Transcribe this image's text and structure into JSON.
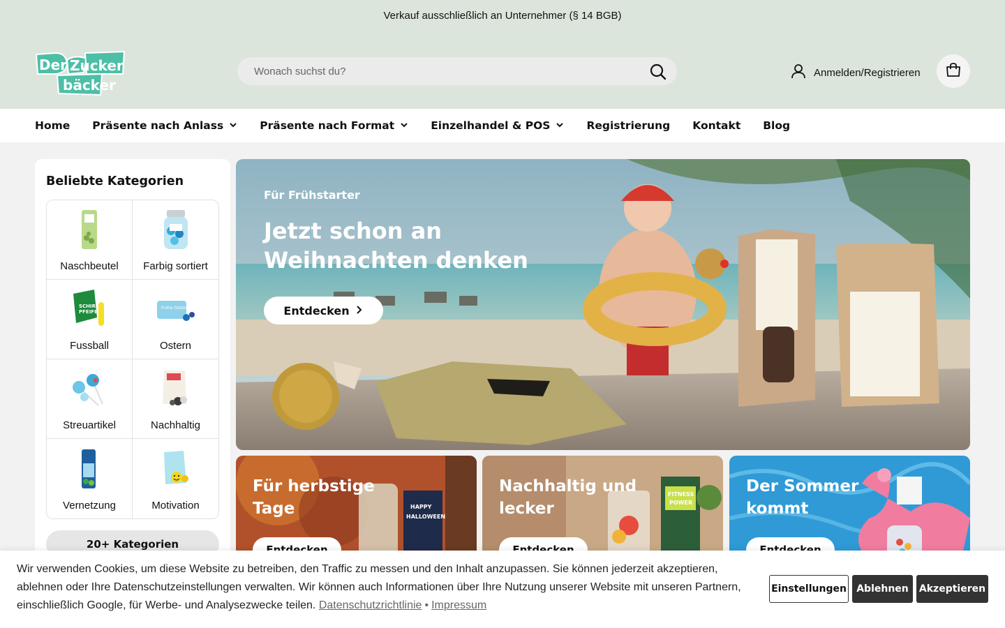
{
  "announcement": "Verkauf ausschließlich an Unternehmer (§ 14 BGB)",
  "brand": {
    "logo_alt": "Der Zucker bäcker",
    "accent": "#4dbfa6"
  },
  "search": {
    "placeholder": "Wonach suchst du?"
  },
  "header": {
    "account_label": "Anmelden/Registrieren"
  },
  "nav": {
    "items": [
      {
        "label": "Home",
        "dropdown": false
      },
      {
        "label": "Präsente nach Anlass",
        "dropdown": true
      },
      {
        "label": "Präsente nach Format",
        "dropdown": true
      },
      {
        "label": "Einzelhandel & POS",
        "dropdown": true
      },
      {
        "label": "Registrierung",
        "dropdown": false
      },
      {
        "label": "Kontakt",
        "dropdown": false
      },
      {
        "label": "Blog",
        "dropdown": false
      }
    ]
  },
  "sidebar": {
    "title": "Beliebte Kategorien",
    "categories": [
      {
        "label": "Naschbeutel",
        "icon": "candy-bag-icon"
      },
      {
        "label": "Farbig sortiert",
        "icon": "candy-jar-icon"
      },
      {
        "label": "Fussball",
        "icon": "whistle-candy-icon"
      },
      {
        "label": "Ostern",
        "icon": "easter-candy-icon"
      },
      {
        "label": "Streuartikel",
        "icon": "lollipop-icon"
      },
      {
        "label": "Nachhaltig",
        "icon": "sustainable-bag-icon"
      },
      {
        "label": "Vernetzung",
        "icon": "gummy-bag-icon"
      },
      {
        "label": "Motivation",
        "icon": "smiley-candy-icon"
      }
    ],
    "more_label": "20+ Kategorien"
  },
  "hero": {
    "subtitle": "Für Frühstarter",
    "title": "Jetzt schon an Weihnachten denken",
    "cta": "Entdecken"
  },
  "tiles": [
    {
      "title": "Für herbstige Tage",
      "cta": "Entdecken"
    },
    {
      "title": "Nachhaltig und lecker",
      "cta": "Entdecken"
    },
    {
      "title": "Der Sommer kommt",
      "cta": "Entdecken"
    }
  ],
  "cookie": {
    "text": "Wir verwenden Cookies, um diese Website zu betreiben, den Traffic zu messen und den Inhalt anzupassen. Sie können jederzeit akzeptieren, ablehnen oder Ihre Datenschutzeinstellungen verwalten. Wir können auch Informationen über Ihre Nutzung unserer Website mit unseren Partnern, einschließlich Google, für Werbe- und Analysezwecke teilen.",
    "privacy_link": "Datenschutzrichtlinie",
    "separator": "•",
    "imprint_link": "Impressum",
    "settings_label": "Einstellungen",
    "decline_label": "Ablehnen",
    "accept_label": "Akzeptieren"
  }
}
